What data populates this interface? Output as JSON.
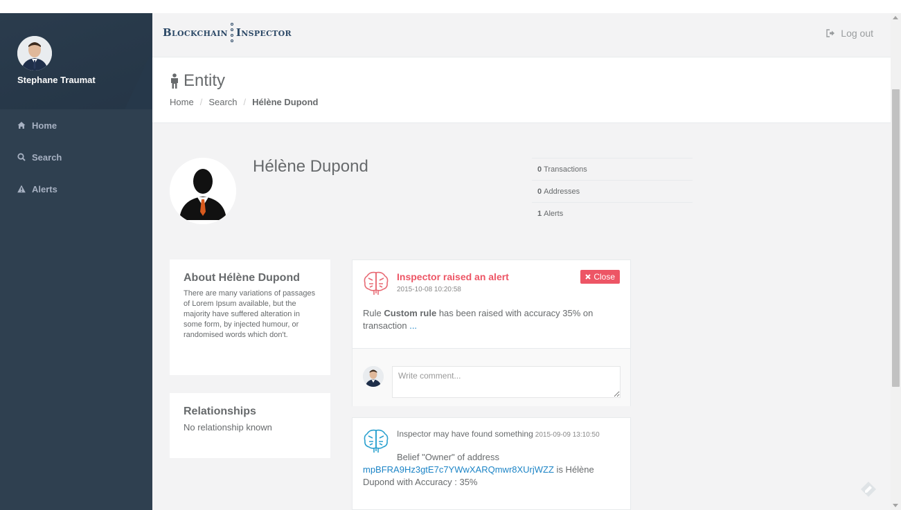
{
  "user": {
    "name": "Stephane Traumat"
  },
  "sidebar": {
    "items": [
      {
        "label": "Home",
        "icon": "home-icon"
      },
      {
        "label": "Search",
        "icon": "search-icon"
      },
      {
        "label": "Alerts",
        "icon": "warning-icon"
      }
    ]
  },
  "topbar": {
    "logo_left": "Blockchain",
    "logo_right": "Inspector",
    "logout_label": "Log out"
  },
  "heading": {
    "title": "Entity",
    "breadcrumb": [
      "Home",
      "Search",
      "Hélène Dupond"
    ]
  },
  "entity": {
    "name": "Hélène Dupond",
    "stats": [
      {
        "count": "0",
        "label": "Transactions"
      },
      {
        "count": "0",
        "label": "Addresses"
      },
      {
        "count": "1",
        "label": "Alerts"
      }
    ]
  },
  "about": {
    "title": "About Hélène Dupond",
    "text": "There are many variations of passages of Lorem Ipsum available, but the majority have suffered alteration in some form, by injected humour, or randomised words which don't."
  },
  "relationships": {
    "title": "Relationships",
    "text": "No relationship known"
  },
  "alert": {
    "title": "Inspector raised an alert",
    "time": "2015-10-08 10:20:58",
    "close_label": "Close",
    "body_prefix": "Rule ",
    "rule_name": "Custom rule",
    "body_suffix": " has been raised with accuracy 35% on transaction ",
    "link_text": "...",
    "comment_placeholder": "Write comment..."
  },
  "belief": {
    "title": "Inspector may have found something",
    "time": "2015-09-09 13:10:50",
    "line1": "Belief \"Owner\" of address",
    "address": "mpBFRA9Hz3gtE7c7YWwXARQmwr8XUrjWZZ",
    "line2": " is Hélène Dupond with Accuracy : 35%"
  },
  "colors": {
    "sidebar": "#2f4050",
    "alert_red": "#ed5565",
    "link_blue": "#1c84c6",
    "brain_alert": "#e86a74",
    "brain_info": "#2aa1cf"
  }
}
